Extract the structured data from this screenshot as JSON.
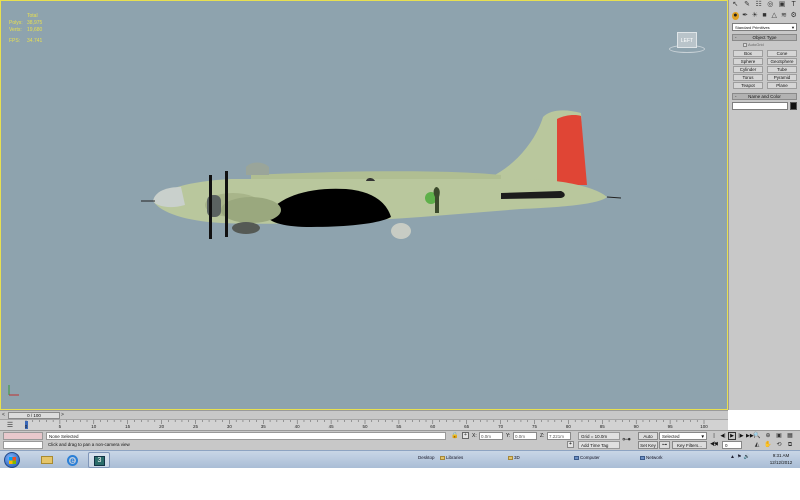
{
  "viewport": {
    "stats": [
      {
        "label": "",
        "value": "Total"
      },
      {
        "label": "Polys:",
        "value": "38,975"
      },
      {
        "label": "Verts:",
        "value": "19,680"
      },
      {
        "label": "FPS:",
        "value": "34.741"
      }
    ],
    "viewcube_label": "LEFT",
    "colors": {
      "background": "#8ea3ae",
      "fuselage": "#b9c79d",
      "tail_red": "#e04535",
      "shadow": "#000000",
      "border": "#e8e050"
    }
  },
  "command_panel": {
    "tabs": [
      {
        "icon": "create-icon",
        "glyph": "↖"
      },
      {
        "icon": "modify-icon",
        "glyph": "✎"
      },
      {
        "icon": "hierarchy-icon",
        "glyph": "☷"
      },
      {
        "icon": "motion-icon",
        "glyph": "◎"
      },
      {
        "icon": "display-icon",
        "glyph": "▣"
      },
      {
        "icon": "utilities-icon",
        "glyph": "T"
      }
    ],
    "categories": [
      {
        "icon": "geometry-icon",
        "glyph": "●"
      },
      {
        "icon": "shapes-icon",
        "glyph": "✒"
      },
      {
        "icon": "lights-icon",
        "glyph": "☀"
      },
      {
        "icon": "cameras-icon",
        "glyph": "■"
      },
      {
        "icon": "helpers-icon",
        "glyph": "△"
      },
      {
        "icon": "spacewarps-icon",
        "glyph": "≋"
      },
      {
        "icon": "systems-icon",
        "glyph": "⚙"
      }
    ],
    "primitive_type": "Standard Primitives",
    "object_type_title": "Object Type",
    "autogrid_label": "AutoGrid",
    "object_buttons": [
      "Box",
      "Cone",
      "Sphere",
      "GeoSphere",
      "Cylinder",
      "Tube",
      "Torus",
      "Pyramid",
      "Teapot",
      "Plane"
    ],
    "name_color_title": "Name and Color",
    "name_value": ""
  },
  "timeline": {
    "slider_label": "0 / 100",
    "prev_glyph": "<",
    "next_glyph": ">",
    "tick_labels": [
      "0",
      "5",
      "10",
      "15",
      "20",
      "25",
      "30",
      "35",
      "40",
      "45",
      "50",
      "55",
      "60",
      "65",
      "70",
      "75",
      "80",
      "85",
      "90",
      "95",
      "100"
    ],
    "current_frame": 0,
    "max_frame": 100
  },
  "status": {
    "selection": "None Selected",
    "prompt": "Click and drag to pan a non-camera view",
    "coord_x_label": "X:",
    "coord_x": "0.0m",
    "coord_y_label": "Y:",
    "coord_y": "0.0m",
    "coord_z_label": "Z:",
    "coord_z": "7.221m",
    "grid": "Grid = 10.0m",
    "add_time_tag": "Add Time Tag",
    "auto_key": "Auto Key",
    "set_key": "Set Key",
    "key_mode": "Selected",
    "key_filters": "Key Filters...",
    "frame": "0",
    "play_glyphs": [
      "|◀◀",
      "◀|",
      "▶",
      "|▶",
      "▶▶|"
    ]
  },
  "taskbar": {
    "desktop_label": "Desktop",
    "links": [
      "Libraries",
      "3D",
      "Computer",
      "Network"
    ],
    "time": "9:31 AM",
    "date": "12/12/2012"
  }
}
